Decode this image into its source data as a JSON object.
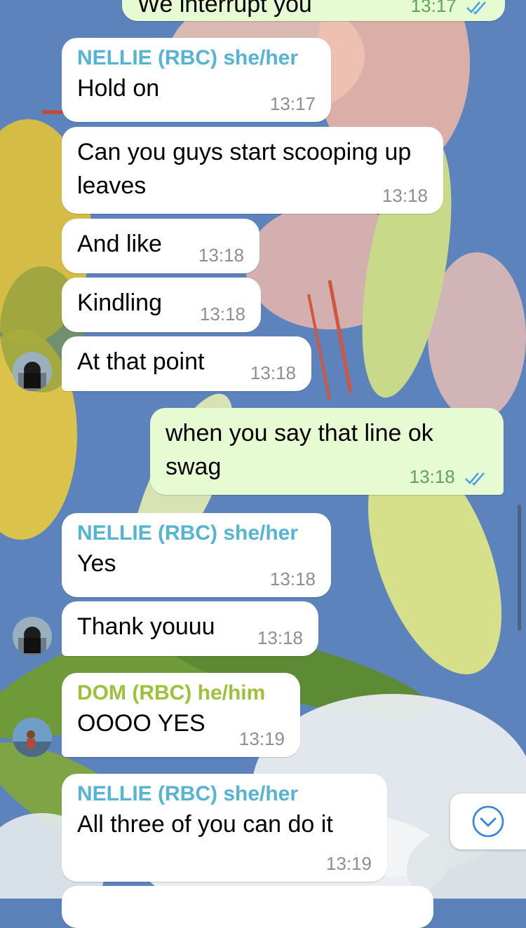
{
  "colors": {
    "incoming_bubble": "#ffffff",
    "outgoing_bubble": "#e7fbd3",
    "nellie_name": "#55b3d3",
    "dom_name": "#9ec13a",
    "timestamp": "#8e8e93",
    "read_ticks": "#4aa1e8"
  },
  "messages": [
    {
      "id": "m0",
      "direction": "out",
      "text": "We interrupt you",
      "time": "13:17",
      "read": true
    },
    {
      "id": "m1",
      "direction": "in",
      "sender": "NELLIE (RBC) she/her",
      "text": "Hold on",
      "time": "13:17"
    },
    {
      "id": "m2",
      "direction": "in",
      "text": "Can you guys start scooping up leaves",
      "time": "13:18"
    },
    {
      "id": "m3",
      "direction": "in",
      "text": "And like",
      "time": "13:18"
    },
    {
      "id": "m4",
      "direction": "in",
      "text": "Kindling",
      "time": "13:18"
    },
    {
      "id": "m5",
      "direction": "in",
      "text": "At that point",
      "time": "13:18",
      "avatar": "nellie-avatar"
    },
    {
      "id": "m6",
      "direction": "out",
      "text": "when you say that line ok swag",
      "time": "13:18",
      "read": true
    },
    {
      "id": "m7",
      "direction": "in",
      "sender": "NELLIE (RBC) she/her",
      "text": "Yes",
      "time": "13:18"
    },
    {
      "id": "m8",
      "direction": "in",
      "text": "Thank youuu",
      "time": "13:18",
      "avatar": "nellie-avatar"
    },
    {
      "id": "m9",
      "direction": "in",
      "sender": "DOM (RBC) he/him",
      "text": "OOOO YES",
      "time": "13:19",
      "avatar": "dom-avatar"
    },
    {
      "id": "m10",
      "direction": "in",
      "sender": "NELLIE (RBC) she/her",
      "text": "All three of you can do it",
      "time": "13:19"
    }
  ],
  "scroll_down_icon": "chevron-down-circle-icon"
}
